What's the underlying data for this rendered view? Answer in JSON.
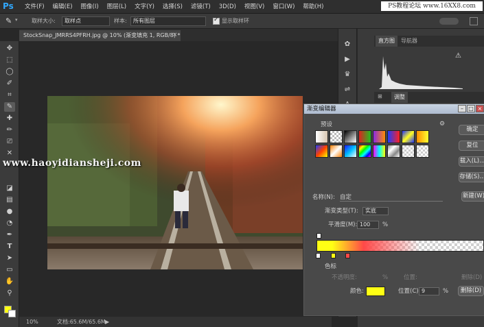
{
  "app": {
    "logo": "Ps",
    "watermark_top": "PS教程论坛 www.16XX8.com"
  },
  "menu": [
    "文件(F)",
    "编辑(E)",
    "图像(I)",
    "图层(L)",
    "文字(Y)",
    "选择(S)",
    "滤镜(T)",
    "3D(D)",
    "视图(V)",
    "窗口(W)",
    "帮助(H)"
  ],
  "options": {
    "sample_size_label": "取样大小:",
    "sample_size_value": "取样点",
    "sample_label": "样本:",
    "sample_value": "所有图层",
    "show_ring_label": "显示取样环"
  },
  "document": {
    "tab_title": "StockSnap_JMRRS4PFRH.jpg @ 10% (渐变填充 1, RGB/8) *",
    "zoom": "10%",
    "doc_size": "文档:65.6M/65.6M"
  },
  "watermark_middle": "www.haoyidiansheji.com",
  "panels": {
    "tab_histogram": "直方图",
    "tab_navigator": "导航器",
    "tab_adjustments": "调整",
    "warning_icon": "warning-icon"
  },
  "dialog": {
    "title": "渐变编辑器",
    "presets_label": "预设",
    "buttons": {
      "ok": "确定",
      "reset": "复位",
      "load": "载入(L)...",
      "save": "存储(S)...",
      "new": "新建(W)",
      "delete": "删除(D)"
    },
    "name_label": "名称(N):",
    "name_value": "自定",
    "type_label": "渐变类型(T):",
    "type_value": "实底",
    "smooth_label": "平滑度(M):",
    "smooth_value": "100",
    "smooth_unit": "%",
    "stops_label": "色标",
    "opacity_label": "不透明度:",
    "opacity_unit": "%",
    "location_label_dim": "位置:",
    "delete_label_dim": "删除(D)",
    "color_label": "颜色:",
    "location_label": "位置(C):",
    "location_value": "9",
    "location_unit": "%",
    "stop_color": "#ffff14"
  },
  "colors": {
    "accent": "#31a8ff",
    "dialog_title": "#b8c6d8"
  }
}
